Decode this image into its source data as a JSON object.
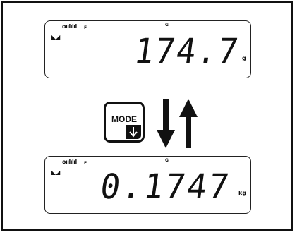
{
  "display_top": {
    "signal_indicator": "oıılılıl",
    "flag_f": "F",
    "flag_g": "G",
    "corner_mark": "◣◢",
    "reading": "174.7",
    "unit": "g"
  },
  "display_bottom": {
    "signal_indicator": "oıılılıl",
    "flag_f": "F",
    "flag_g": "G",
    "corner_mark": "◣◢",
    "reading": "0.1747",
    "unit": "kg"
  },
  "mode_button": {
    "label": "MODE",
    "icon": "arrow-down-icon"
  },
  "conversion_arrows": {
    "icon": "up-down-arrows-icon"
  }
}
